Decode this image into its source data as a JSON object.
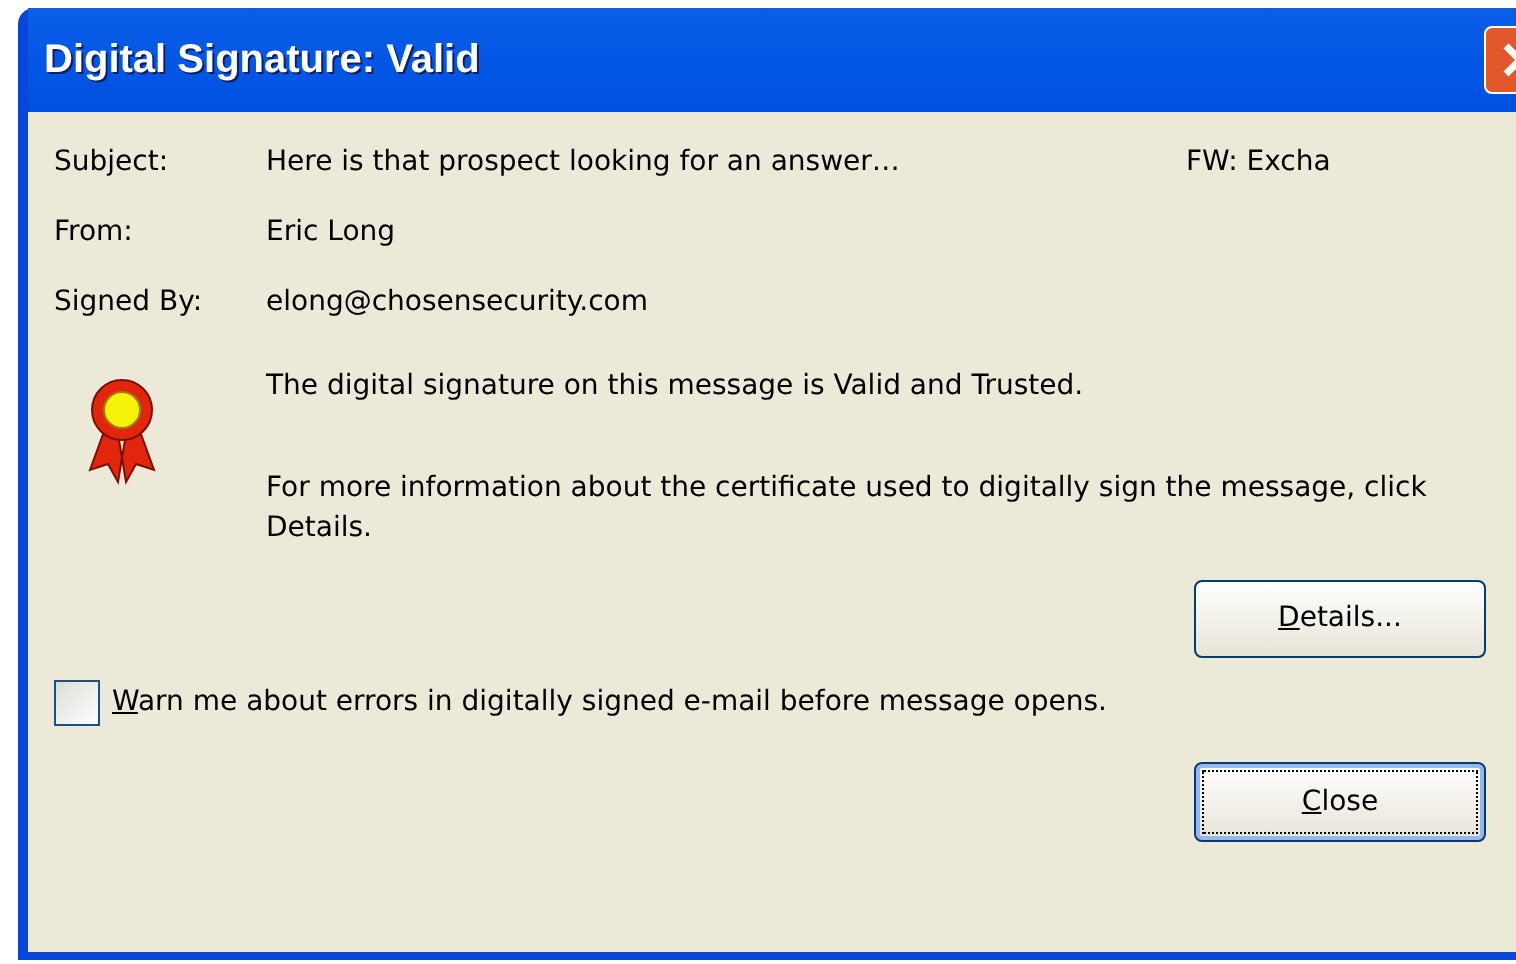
{
  "window": {
    "title": "Digital Signature: Valid"
  },
  "fields": [
    {
      "label": "Subject:",
      "value": "Here is that prospect looking for an answer…",
      "extra": "FW: Excha"
    },
    {
      "label": "From:",
      "value": "Eric Long"
    },
    {
      "label": "Signed By:",
      "value": "elong@chosensecurity.com"
    }
  ],
  "status_message": "The digital signature on this message is Valid and Trusted.",
  "info_message": "For more information about the certificate used to digitally sign the message, click Details.",
  "details_button": "Details...",
  "warn_checkbox": {
    "label": "Warn me about errors in digitally signed e-mail before message opens.",
    "checked": false
  },
  "close_button": "Close"
}
